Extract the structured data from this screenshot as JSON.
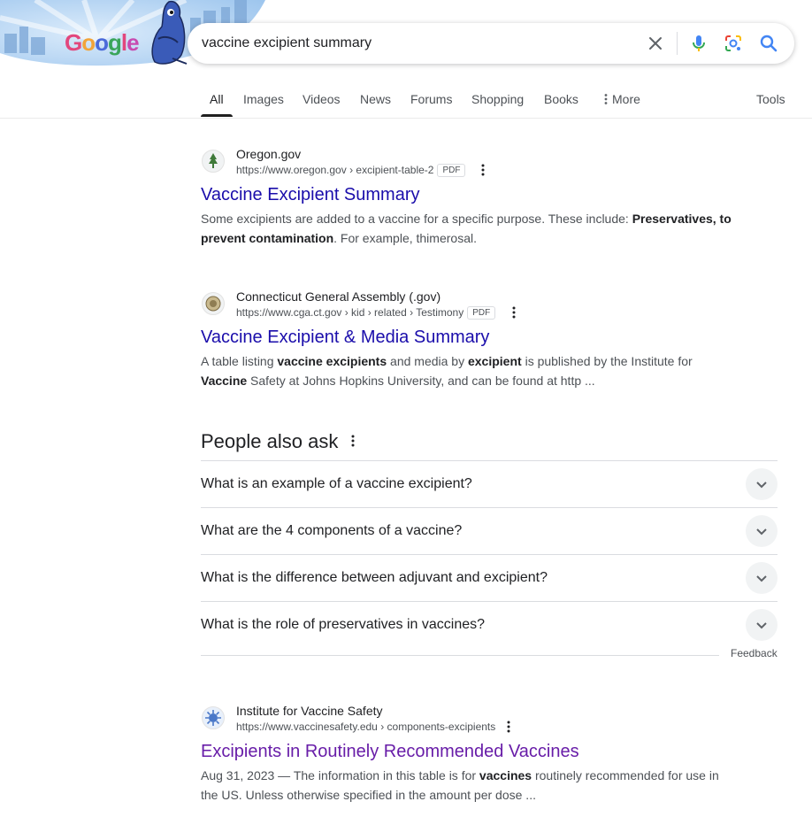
{
  "search": {
    "query": "vaccine excipient summary"
  },
  "doodle": {
    "logo_text": "Google"
  },
  "tabs": [
    {
      "label": "All",
      "active": true
    },
    {
      "label": "Images"
    },
    {
      "label": "Videos"
    },
    {
      "label": "News"
    },
    {
      "label": "Forums"
    },
    {
      "label": "Shopping"
    },
    {
      "label": "Books"
    },
    {
      "label": "More"
    }
  ],
  "tools_label": "Tools",
  "results": [
    {
      "site": "Oregon.gov",
      "url": "https://www.oregon.gov › excipient-table-2",
      "badge": "PDF",
      "title": "Vaccine Excipient Summary",
      "snippet_a": "Some excipients are added to a vaccine for a specific purpose. These include: ",
      "snippet_b": "Preservatives, to prevent contamination",
      "snippet_c": ". For example, thimerosal."
    },
    {
      "site": "Connecticut General Assembly (.gov)",
      "url": "https://www.cga.ct.gov › kid › related › Testimony",
      "badge": "PDF",
      "title": "Vaccine Excipient & Media Summary",
      "snippet_a": "A table listing ",
      "snippet_b": "vaccine excipients",
      "snippet_c": " and media by ",
      "snippet_d": "excipient",
      "snippet_e": " is published by the Institute for ",
      "snippet_f": "Vaccine",
      "snippet_g": " Safety at Johns Hopkins University, and can be found at http ..."
    },
    {
      "site": "Institute for Vaccine Safety",
      "url": "https://www.vaccinesafety.edu › components-excipients",
      "title": "Excipients in Routinely Recommended Vaccines",
      "snippet_a": "Aug 31, 2023 — The information in this table is for ",
      "snippet_b": "vaccines",
      "snippet_c": " routinely recommended for use in the US. Unless otherwise specified in the amount per dose ..."
    }
  ],
  "paa": {
    "title": "People also ask",
    "questions": [
      "What is an example of a vaccine excipient?",
      "What are the 4 components of a vaccine?",
      "What is the difference between adjuvant and excipient?",
      "What is the role of preservatives in vaccines?"
    ],
    "feedback": "Feedback"
  },
  "colors": {
    "link": "#1a0dab",
    "visited": "#681da8",
    "search_blue": "#4285f4"
  }
}
